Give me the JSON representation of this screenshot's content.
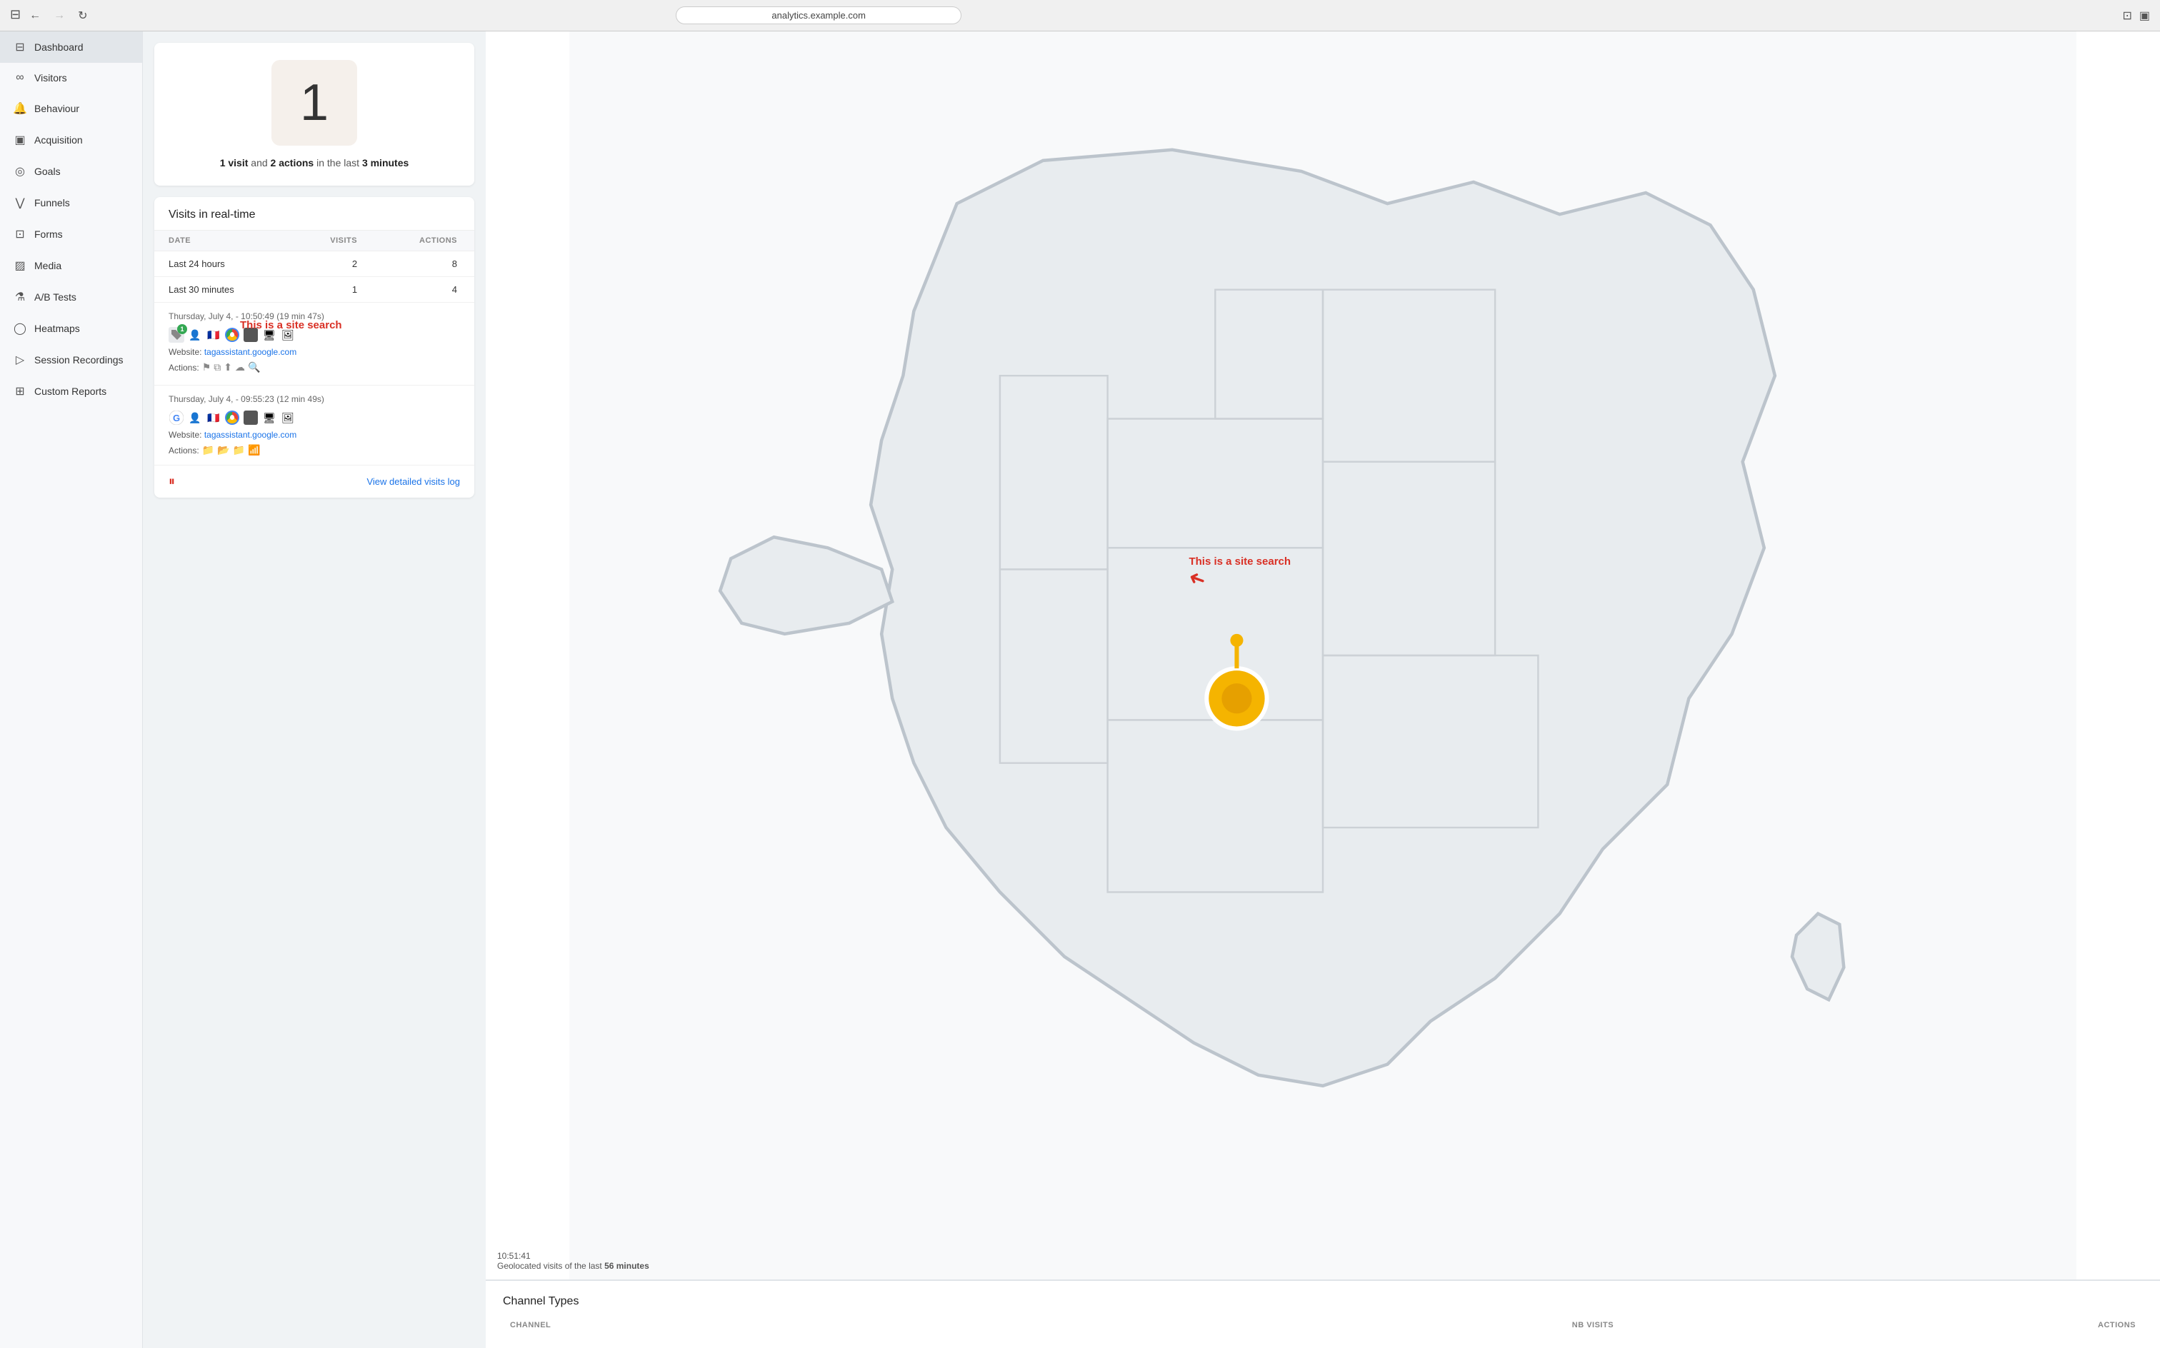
{
  "browser": {
    "address": "analytics.example.com",
    "back_disabled": false,
    "forward_disabled": true
  },
  "sidebar": {
    "active_item": "dashboard",
    "items": [
      {
        "id": "dashboard",
        "label": "Dashboard",
        "icon": "⊟"
      },
      {
        "id": "visitors",
        "label": "Visitors",
        "icon": "∞"
      },
      {
        "id": "behaviour",
        "label": "Behaviour",
        "icon": "🔔"
      },
      {
        "id": "acquisition",
        "label": "Acquisition",
        "icon": "▣"
      },
      {
        "id": "goals",
        "label": "Goals",
        "icon": "◎"
      },
      {
        "id": "funnels",
        "label": "Funnels",
        "icon": "⋁"
      },
      {
        "id": "forms",
        "label": "Forms",
        "icon": "⊡"
      },
      {
        "id": "media",
        "label": "Media",
        "icon": "▨"
      },
      {
        "id": "abtests",
        "label": "A/B Tests",
        "icon": "⚗"
      },
      {
        "id": "heatmaps",
        "label": "Heatmaps",
        "icon": "◯"
      },
      {
        "id": "session-recordings",
        "label": "Session Recordings",
        "icon": "▷"
      },
      {
        "id": "custom-reports",
        "label": "Custom Reports",
        "icon": "⊞"
      }
    ]
  },
  "visit_count": {
    "number": "1",
    "summary_text": " visit and ",
    "actions_text": "2 actions",
    "suffix": " in the last ",
    "time_bold": "3",
    "time_unit": " minutes"
  },
  "realtime": {
    "title": "Visits in real-time",
    "columns": {
      "date": "DATE",
      "visits": "VISITS",
      "actions": "ACTIONS"
    },
    "rows": [
      {
        "label": "Last 24 hours",
        "visits": "2",
        "actions": "8"
      },
      {
        "label": "Last 30 minutes",
        "visits": "1",
        "actions": "4"
      }
    ]
  },
  "visits": [
    {
      "timestamp": "Thursday, July 4, - 10:50:49 (19 min 47s)",
      "website_label": "Website: ",
      "website_url": "tagassistant.google.com",
      "actions_label": "Actions:",
      "annotation": "This is a site search",
      "has_annotation": true
    },
    {
      "timestamp": "Thursday, July 4, - 09:55:23 (12 min 49s)",
      "website_label": "Website: ",
      "website_url": "tagassistant.google.com",
      "actions_label": "Actions:",
      "has_annotation": false
    }
  ],
  "footer": {
    "view_log": "View detailed visits log"
  },
  "map": {
    "timestamp": "10:51:41",
    "geo_text": "Geolocated visits of the last ",
    "geo_minutes": "56 minutes"
  },
  "channel_types": {
    "title": "Channel Types",
    "columns": {
      "channel": "CHANNEL",
      "nb_visits": "NB VISITS",
      "actions": "ACTIONS"
    }
  }
}
